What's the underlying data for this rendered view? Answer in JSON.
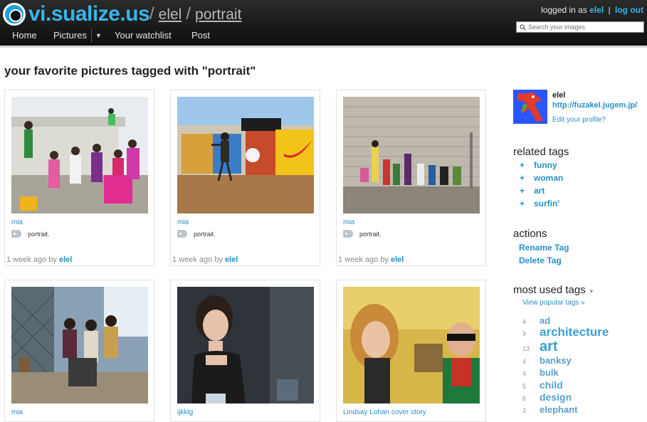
{
  "header": {
    "logo_text": "vi.sualize.us",
    "crumb_sep": "/",
    "crumb_user": "elel",
    "crumb_tag": "portrait",
    "logged_in_prefix": "logged in as",
    "logged_in_user": "elel",
    "separator": "|",
    "logout": "log out",
    "search_placeholder": "Search your images",
    "nav": {
      "home": "Home",
      "pictures": "Pictures",
      "dropdown": "▼",
      "watchlist": "Your watchlist",
      "post": "Post"
    }
  },
  "page_title": "your favorite pictures tagged with \"portrait\"",
  "cards": [
    {
      "owner": "mia",
      "tag": "portrait.",
      "time": "1 week ago by",
      "user": "elel"
    },
    {
      "owner": "mia",
      "tag": "portrait.",
      "time": "1 week ago by",
      "user": "elel"
    },
    {
      "owner": "mia",
      "tag": "portrait.",
      "time": "1 week ago by",
      "user": "elel"
    },
    {
      "owner": "mia"
    },
    {
      "owner": "ijkklg"
    },
    {
      "owner": "Lindsay Lohan cover story"
    }
  ],
  "profile": {
    "name": "elel",
    "url": "http://fuzakel.jugem.jp/",
    "edit": "Edit your profile?"
  },
  "related_tags": {
    "heading": "related tags",
    "plus": "+",
    "items": [
      "funny",
      "woman",
      "art",
      "surfin'"
    ]
  },
  "actions": {
    "heading": "actions",
    "rename": "Rename Tag",
    "delete": "Delete Tag"
  },
  "most_used": {
    "heading": "most used tags",
    "caret": "▼",
    "view_popular": "View popular tags »",
    "items": [
      {
        "count": "4",
        "tag": "ad"
      },
      {
        "count": "9",
        "tag": "architecture"
      },
      {
        "count": "13",
        "tag": "art"
      },
      {
        "count": "4",
        "tag": "banksy"
      },
      {
        "count": "4",
        "tag": "bulk"
      },
      {
        "count": "5",
        "tag": "child"
      },
      {
        "count": "6",
        "tag": "design"
      },
      {
        "count": "3",
        "tag": "elephant"
      }
    ]
  },
  "colors": {
    "accent": "#2a8fc4",
    "logo": "#3ab4ea",
    "header_bg": "#111111"
  }
}
